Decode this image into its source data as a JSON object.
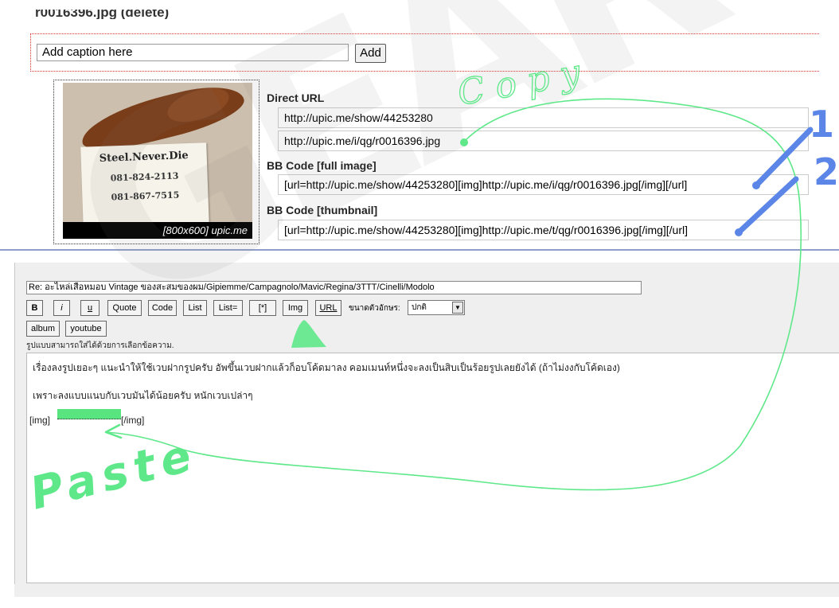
{
  "upload": {
    "title": "r0016396.jpg (delete)",
    "caption_placeholder": "Add caption here",
    "add_label": "Add",
    "thumbnail": {
      "card_line1": "Steel.Never.Die",
      "card_line2": "081-824-2113",
      "card_line3": "081-867-7515",
      "caption": "[800x600] upic.me"
    },
    "direct_url_label": "Direct URL",
    "direct_url_show": "http://upic.me/show/44253280",
    "direct_url_image": "http://upic.me/i/qg/r0016396.jpg",
    "bb_full_label": "BB Code [full image]",
    "bb_full_value": "[url=http://upic.me/show/44253280][img]http://upic.me/i/qg/r0016396.jpg[/img][/url]",
    "bb_thumb_label": "BB Code [thumbnail]",
    "bb_thumb_value": "[url=http://upic.me/show/44253280][img]http://upic.me/t/qg/r0016396.jpg[/img][/url]"
  },
  "editor": {
    "subject": "Re: อะไหล่เสือหมอบ Vintage ของสะสมของผม/Gipiemme/Campagnolo/Mavic/Regina/3TTT/Cinelli/Modolo",
    "toolbar_row1": [
      "B",
      "i",
      "u",
      "Quote",
      "Code",
      "List",
      "List=",
      "[*]",
      "Img",
      "URL"
    ],
    "toolbar_row2": [
      "album",
      "youtube"
    ],
    "font_size_label": "ขนาดตัวอักษร:",
    "font_size_value": "ปกติ",
    "hint": "รูปแบบสามารถใส่ได้ด้วยการเลือกข้อความ.",
    "body_line1": "เรื่องลงรูปเยอะๆ แนะนำให้ใช้เวบฝากรูปครับ  อัพขึ้นเวบฝากแล้วก็อบโค้ดมาลง คอมเมนท์หนึ่งจะลงเป็นสิบเป็นร้อยรูปเลยยังได้ (ถ้าไม่งงกับโค้ดเอง)",
    "body_line2": "เพราะลงแบบแนบกับเวบมันได้น้อยครับ หนักเวบเปล่าๆ",
    "img_open": "[img]",
    "img_close": "[/img]"
  },
  "annotations": {
    "copy_text": "Copy",
    "paste_text": "Paste",
    "num1": "1",
    "num2": "2",
    "green": "#5ee88a",
    "blue": "#5b86e8"
  }
}
